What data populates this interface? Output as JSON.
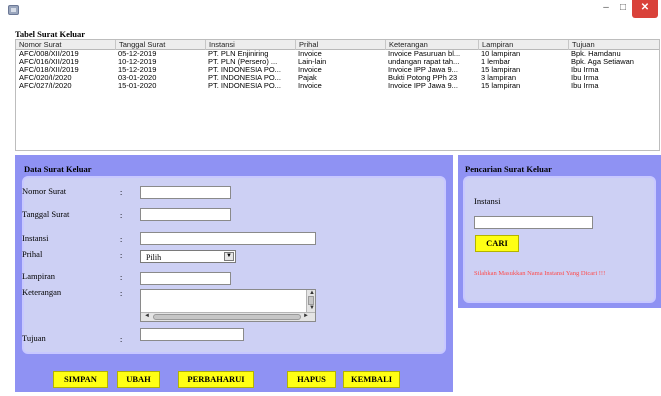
{
  "window": {
    "minimize": "–",
    "maximize": "□",
    "close": "✕"
  },
  "table": {
    "title": "Tabel Surat Keluar",
    "columns": [
      "Nomor Surat",
      "Tanggal Surat",
      "Instansi",
      "Prihal",
      "Keterangan",
      "Lampiran",
      "Tujuan"
    ],
    "rows": [
      [
        "AFC/008/XII/2019",
        "05-12-2019",
        "PT. PLN Enjiniring",
        "Invoice",
        "Invoice Pasuruan bl...",
        "10 lampiran",
        "Bpk. Hamdanu"
      ],
      [
        "AFC/016/XII/2019",
        "10-12-2019",
        "PT. PLN (Persero) ...",
        "Lain-lain",
        "undangan rapat tah...",
        "1 lembar",
        "Bpk. Aga Setiawan"
      ],
      [
        "AFC/018/XII/2019",
        "15-12-2019",
        "PT. INDONESIA PO...",
        "Invoice",
        "Invoice IPP Jawa 9...",
        "15 lampiran",
        "Ibu Irma"
      ],
      [
        "AFC/020/I/2020",
        "03-01-2020",
        "PT. INDONESIA PO...",
        "Pajak",
        "Bukti Potong PPh 23",
        "3 lampiran",
        "Ibu Irma"
      ],
      [
        "AFC/027/I/2020",
        "15-01-2020",
        "PT. INDONESIA PO...",
        "Invoice",
        "Invoice IPP Jawa 9...",
        "15 lampiran",
        "Ibu Irma"
      ]
    ]
  },
  "form": {
    "title": "Data Surat Keluar",
    "colon": ":",
    "labels": {
      "nomor": "Nomor Surat",
      "tanggal": "Tanggal Surat",
      "instansi": "Instansi",
      "prihal": "Prihal",
      "lampiran": "Lampiran",
      "keterangan": "Keterangan",
      "tujuan": "Tujuan"
    },
    "prihal_selected": "Pilih",
    "buttons": {
      "simpan": "SIMPAN",
      "ubah": "UBAH",
      "perbaharui": "PERBAHARUI",
      "hapus": "HAPUS",
      "kembali": "KEMBALI"
    }
  },
  "search": {
    "title": "Pencarian Surat Keluar",
    "label": "Instansi",
    "button": "CARI",
    "hint": "Silahkan Masukkan Nama Instansi Yang Dicari !!!"
  },
  "colors": {
    "panel": "#8f92f3",
    "panel_inner": "#cdd0f4",
    "button": "#ffff14",
    "hint": "#ff4a4a",
    "close": "#d9423a"
  }
}
